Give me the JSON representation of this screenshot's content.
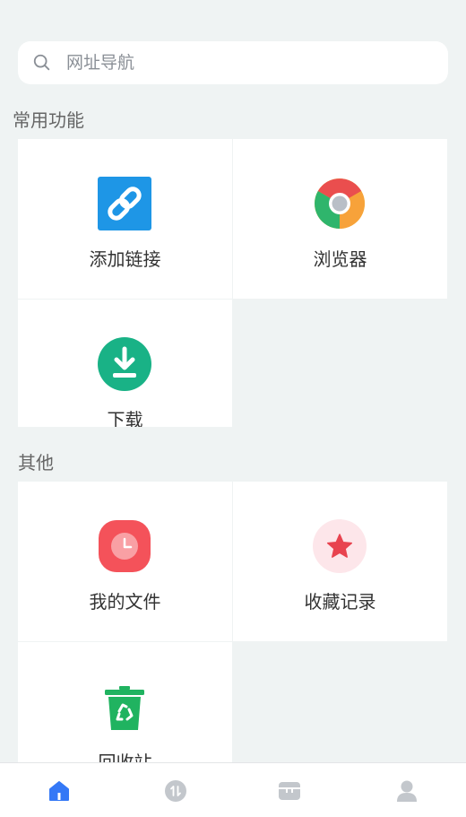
{
  "search": {
    "placeholder": "网址导航"
  },
  "sections": {
    "common": {
      "title": "常用功能",
      "items": [
        {
          "label": "添加链接",
          "icon": "link-icon"
        },
        {
          "label": "浏览器",
          "icon": "chrome-browser-icon"
        },
        {
          "label": "下载",
          "icon": "download-icon"
        }
      ]
    },
    "other": {
      "title": "其他",
      "items": [
        {
          "label": "我的文件",
          "icon": "clock-icon"
        },
        {
          "label": "收藏记录",
          "icon": "star-icon"
        },
        {
          "label": "回收站",
          "icon": "recycle-bin-icon"
        }
      ]
    }
  },
  "tabbar": {
    "tabs": [
      {
        "name": "home",
        "icon": "home-icon",
        "active": true
      },
      {
        "name": "transfer",
        "icon": "transfer-icon",
        "active": false
      },
      {
        "name": "toolbox",
        "icon": "box-icon",
        "active": false
      },
      {
        "name": "profile",
        "icon": "user-icon",
        "active": false
      }
    ]
  },
  "colors": {
    "background": "#eff3f3",
    "accent": "#3478f6",
    "tab_inactive": "#c3c7cc",
    "link_blue": "#1e96e6",
    "download_green": "#19b286",
    "file_red": "#f4525a",
    "star_red": "#e8434f",
    "star_bg": "#fde6ea",
    "bin_green": "#20b360"
  }
}
